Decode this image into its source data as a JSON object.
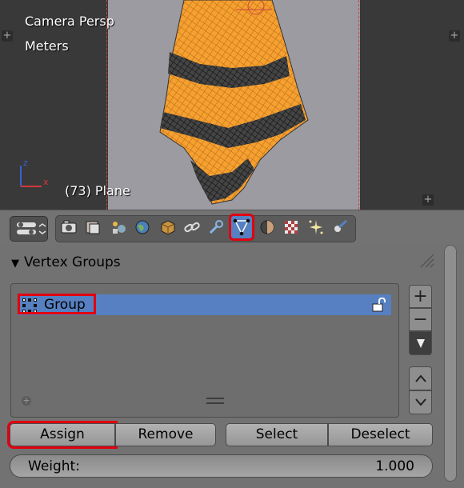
{
  "viewport": {
    "view_name": "Camera Persp",
    "unit_name": "Meters",
    "object_info": "(73) Plane",
    "axis_z": "z",
    "axis_x": "x",
    "corner_plus": "+"
  },
  "properties": {
    "active_tab": "object-data",
    "tabs": [
      "render-icon",
      "render-layers-icon",
      "scene-icon",
      "world-icon",
      "object-icon",
      "constraints-icon",
      "modifiers-icon",
      "object-data-icon",
      "material-icon",
      "texture-icon",
      "particles-icon",
      "physics-icon"
    ],
    "panel": {
      "title": "Vertex Groups",
      "vertex_groups": [
        {
          "name": "Group"
        }
      ],
      "add_symbol": "+",
      "remove_symbol": "−",
      "list_add_symbol": "+",
      "buttons": {
        "assign": "Assign",
        "remove": "Remove",
        "select": "Select",
        "deselect": "Deselect"
      },
      "weight": {
        "label": "Weight:",
        "value": "1.000"
      }
    }
  },
  "colors": {
    "accent_selection": "#5680c2",
    "highlight_box": "#e00010",
    "cloth_mesh": "#f5a031"
  }
}
